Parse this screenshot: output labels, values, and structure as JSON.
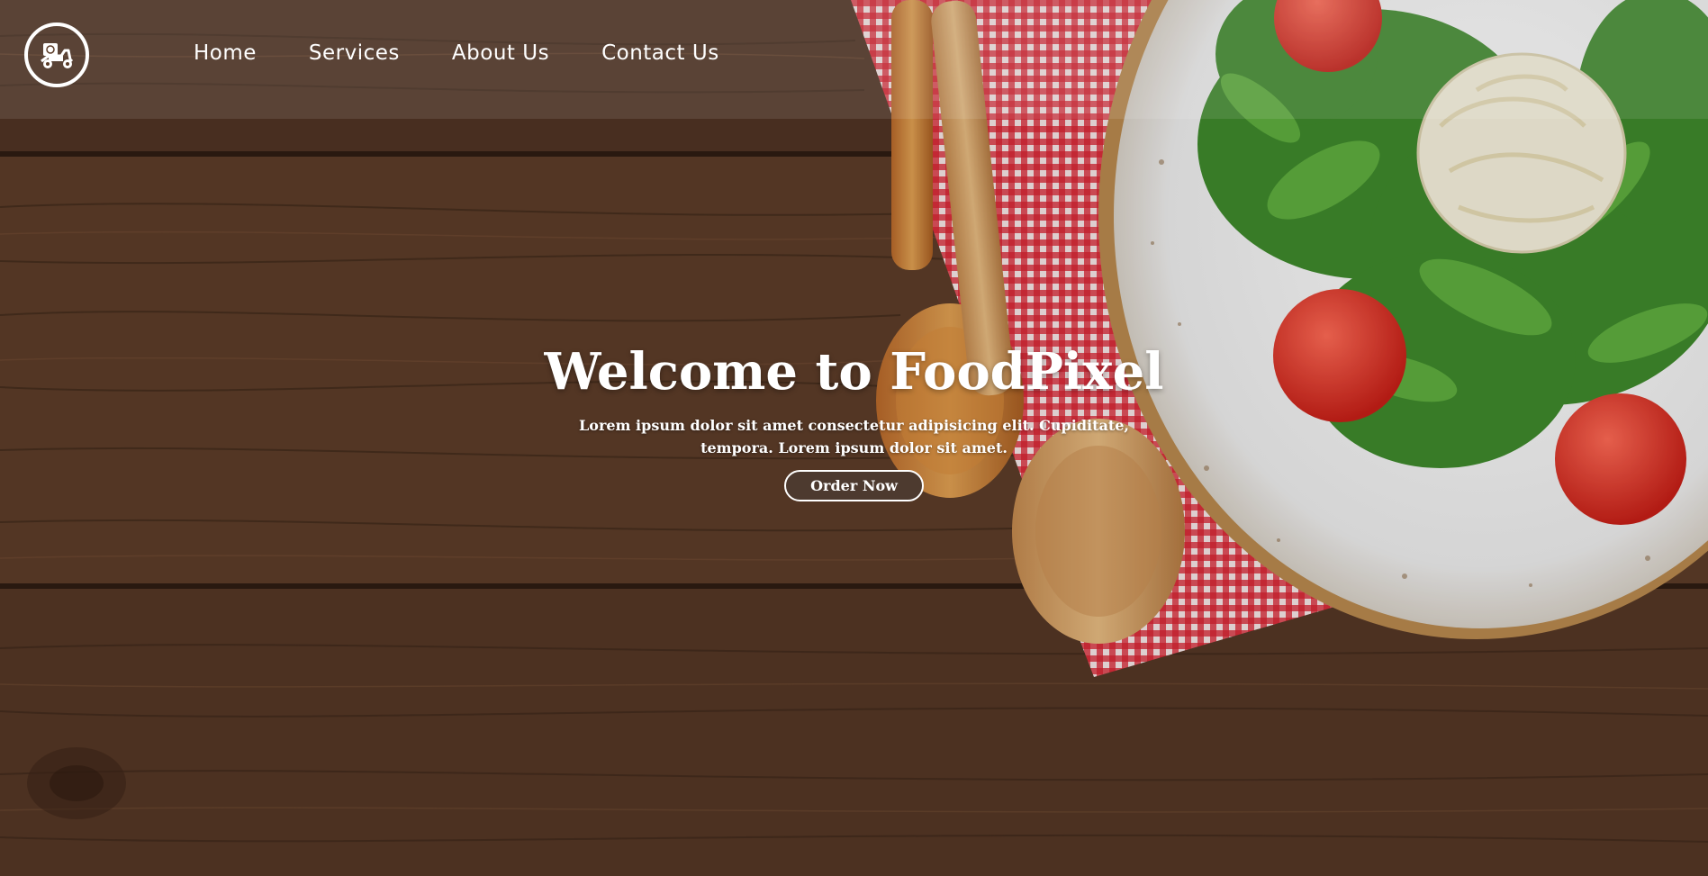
{
  "brand": {
    "logo_icon": "delivery-scooter-icon"
  },
  "nav": {
    "items": [
      {
        "label": "Home"
      },
      {
        "label": "Services"
      },
      {
        "label": "About Us"
      },
      {
        "label": "Contact Us"
      }
    ]
  },
  "hero": {
    "title": "Welcome to FoodPixel",
    "subtitle": "Lorem ipsum dolor sit amet consectetur adipisicing elit. Cupiditate, tempora. Lorem ipsum dolor sit amet.",
    "cta_label": "Order Now"
  },
  "colors": {
    "wood": "#5a3a26",
    "text": "#ffffff",
    "button_bg": "#4d3a2f",
    "napkin_red": "#d8202e",
    "tomato": "#e33a2c",
    "arugula": "#3f8a2c"
  }
}
